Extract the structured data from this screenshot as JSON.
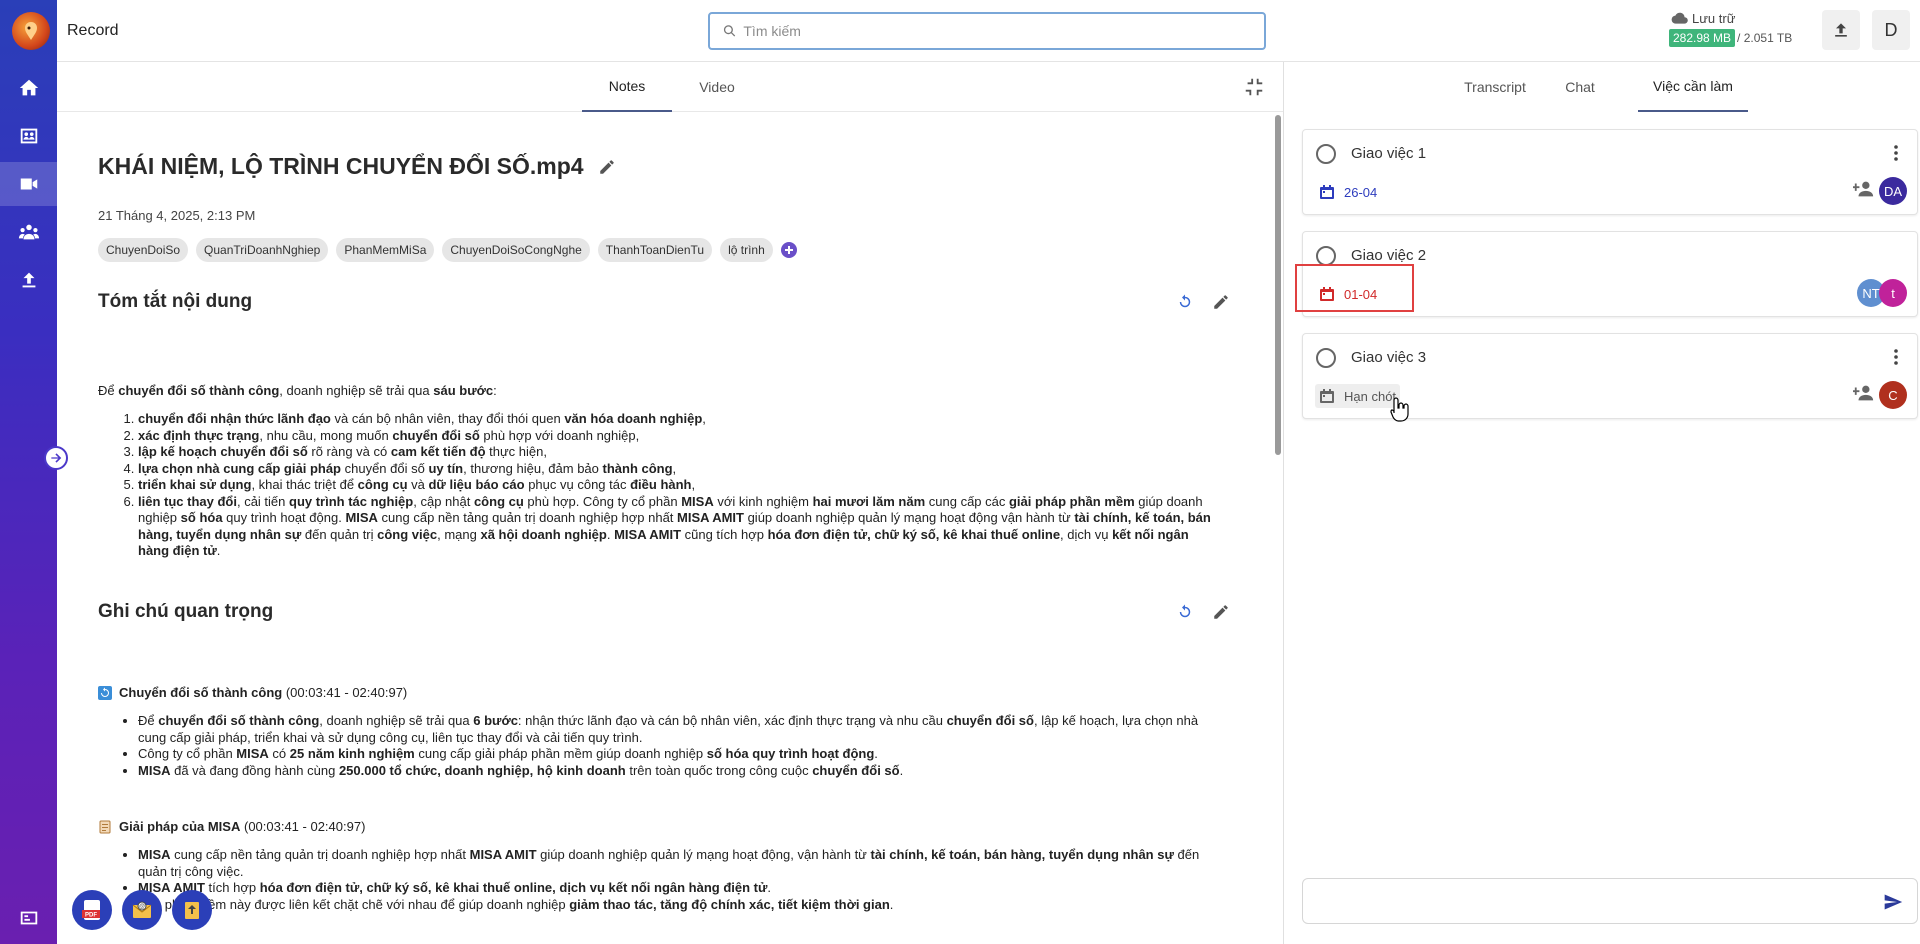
{
  "app": {
    "title": "Record"
  },
  "search": {
    "placeholder": "Tìm kiếm"
  },
  "storage": {
    "label": "Lưu trữ",
    "used": "282.98 MB",
    "total": "/ 2.051 TB"
  },
  "header": {
    "user_initial": "D"
  },
  "left_tabs": [
    {
      "label": "Notes",
      "active": true
    },
    {
      "label": "Video",
      "active": false
    }
  ],
  "document": {
    "title": "KHÁI NIỆM, LỘ TRÌNH CHUYỂN ĐỔI SỐ.mp4",
    "date": "21 Tháng 4, 2025, 2:13 PM",
    "tags": [
      "ChuyenDoiSo",
      "QuanTriDoanhNghiep",
      "PhanMemMiSa",
      "ChuyenDoiSoCongNghe",
      "ThanhToanDienTu",
      "lộ trình"
    ],
    "summary_title": "Tóm tắt nội dung",
    "important_title": "Ghi chú quan trọng"
  },
  "notes": [
    {
      "title": "Chuyển đổi số thành công",
      "time": "(00:03:41 - 02:40:97)"
    },
    {
      "title": "Giải pháp của MISA",
      "time": "(00:03:41 - 02:40:97)"
    }
  ],
  "right_tabs": [
    {
      "label": "Transcript",
      "active": false
    },
    {
      "label": "Chat",
      "active": false
    },
    {
      "label": "Việc cần làm",
      "active": true
    }
  ],
  "tasks": [
    {
      "title": "Giao việc 1",
      "due": "26-04",
      "due_state": "upcoming",
      "assignees": [
        {
          "initials": "DA",
          "color": "#3b2a9e"
        }
      ]
    },
    {
      "title": "Giao việc 2",
      "due": "01-04",
      "due_state": "overdue",
      "assignees": [
        {
          "initials": "NT",
          "color": "#5f8fd0"
        },
        {
          "initials": "t",
          "color": "#c0229a"
        }
      ]
    },
    {
      "title": "Giao việc 3",
      "due": "Hạn chót",
      "due_state": "unset",
      "assignees": [
        {
          "initials": "C",
          "color": "#b0301e"
        }
      ]
    }
  ],
  "colors": {
    "accent": "#2b3fb8",
    "overdue": "#d12a2a",
    "storage_used": "#3fb57b"
  }
}
